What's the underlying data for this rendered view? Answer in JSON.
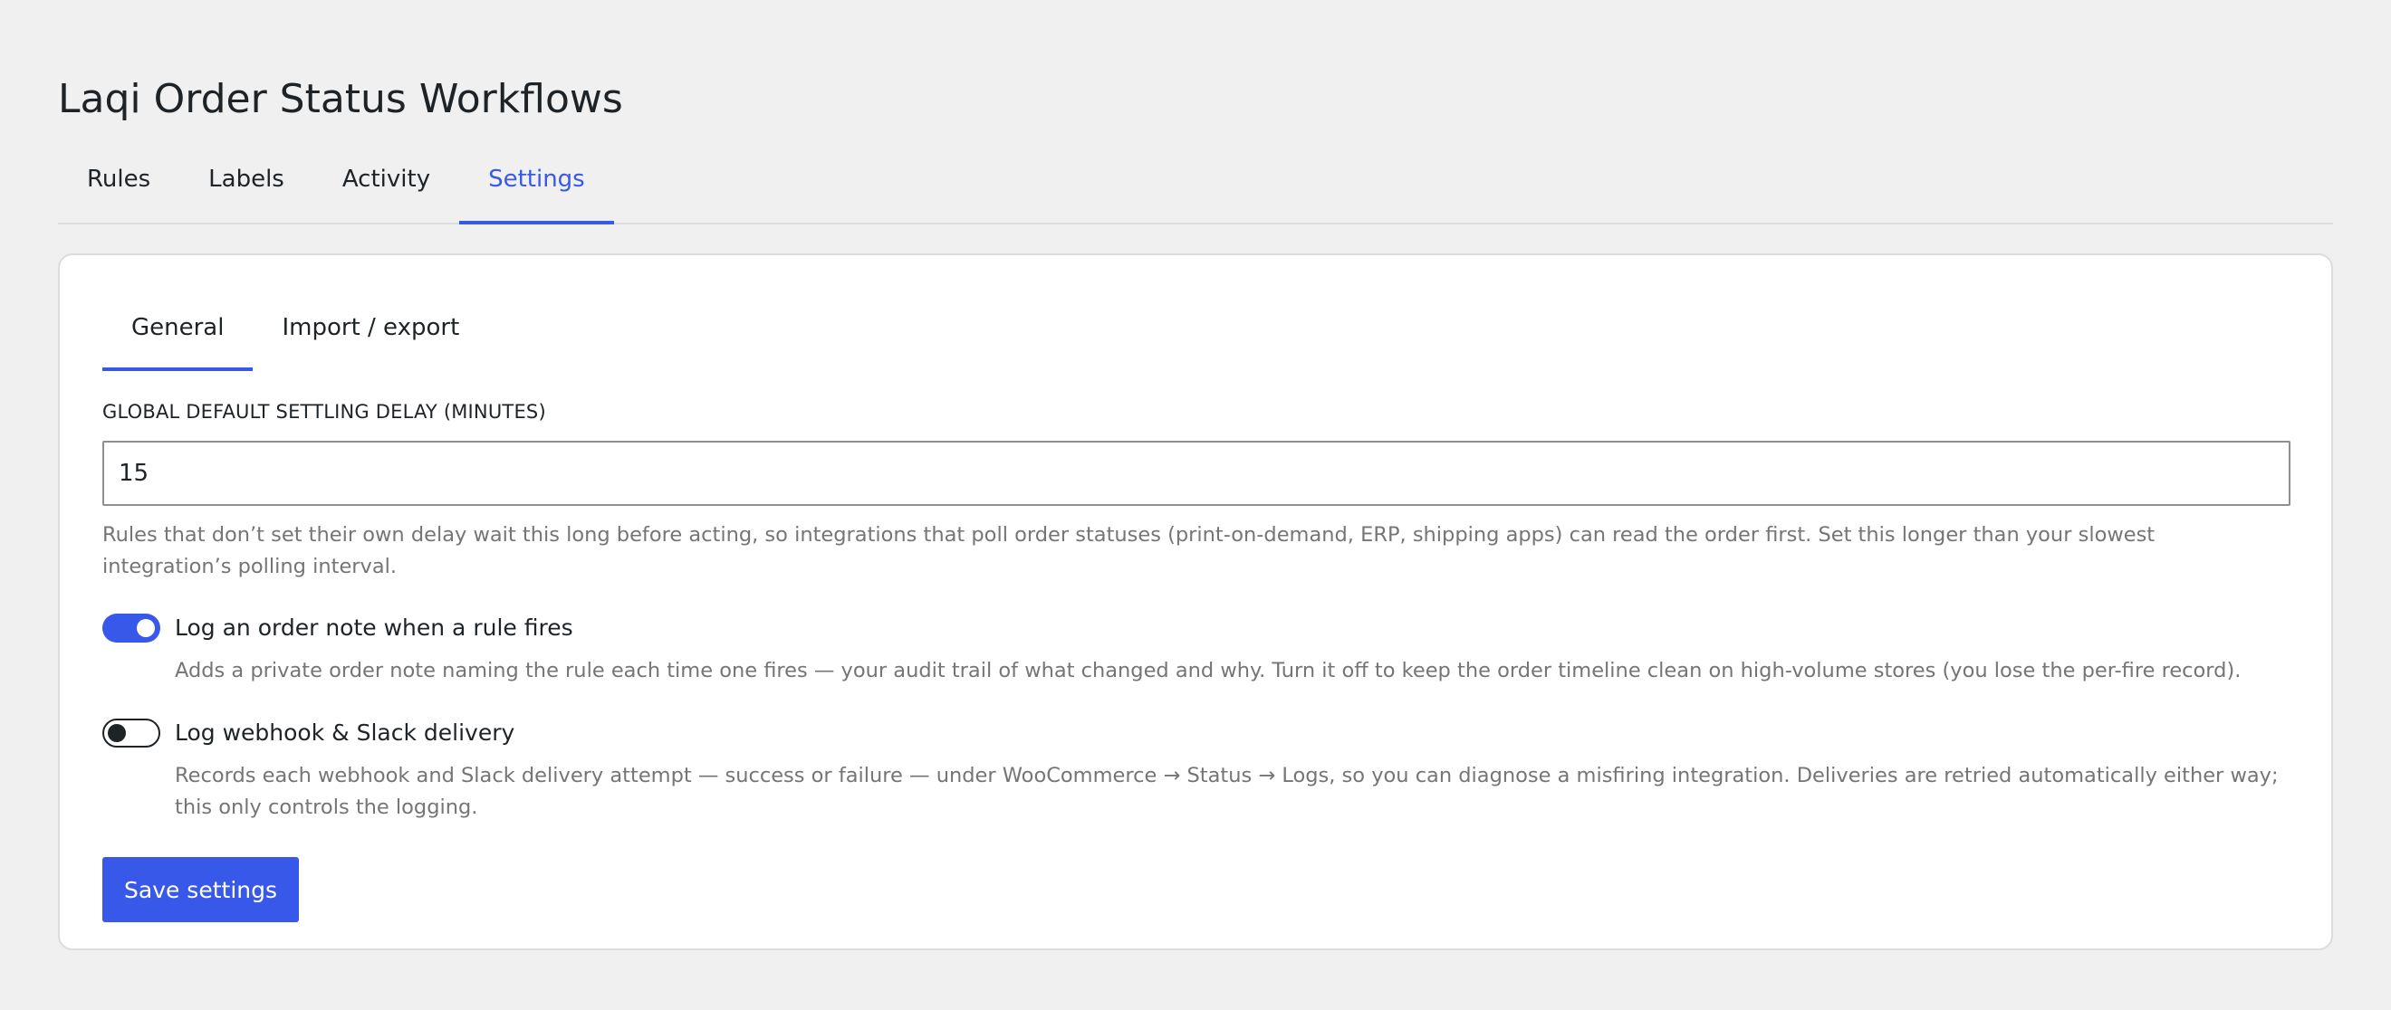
{
  "page": {
    "title": "Laqi Order Status Workflows"
  },
  "main_tabs": [
    {
      "label": "Rules",
      "active": false
    },
    {
      "label": "Labels",
      "active": false
    },
    {
      "label": "Activity",
      "active": false
    },
    {
      "label": "Settings",
      "active": true
    }
  ],
  "sub_tabs": [
    {
      "label": "General",
      "active": true
    },
    {
      "label": "Import / export",
      "active": false
    }
  ],
  "settings": {
    "delay_label": "GLOBAL DEFAULT SETTLING DELAY (MINUTES)",
    "delay_value": "15",
    "delay_help": "Rules that don’t set their own delay wait this long before acting, so integrations that poll order statuses (print-on-demand, ERP, shipping apps) can read the order first. Set this longer than your slowest integration’s polling interval.",
    "order_note_toggle": {
      "label": "Log an order note when a rule fires",
      "enabled": true,
      "help": "Adds a private order note naming the rule each time one fires — your audit trail of what changed and why. Turn it off to keep the order timeline clean on high-volume stores (you lose the per-fire record)."
    },
    "webhook_toggle": {
      "label": "Log webhook & Slack delivery",
      "enabled": false,
      "help": "Records each webhook and Slack delivery attempt — success or failure — under WooCommerce → Status → Logs, so you can diagnose a misfiring integration. Deliveries are retried automatically either way; this only controls the logging."
    },
    "save_label": "Save settings"
  },
  "colors": {
    "accent": "#3858e9",
    "background": "#f0f0f1",
    "card": "#ffffff",
    "help_text": "#757575"
  }
}
